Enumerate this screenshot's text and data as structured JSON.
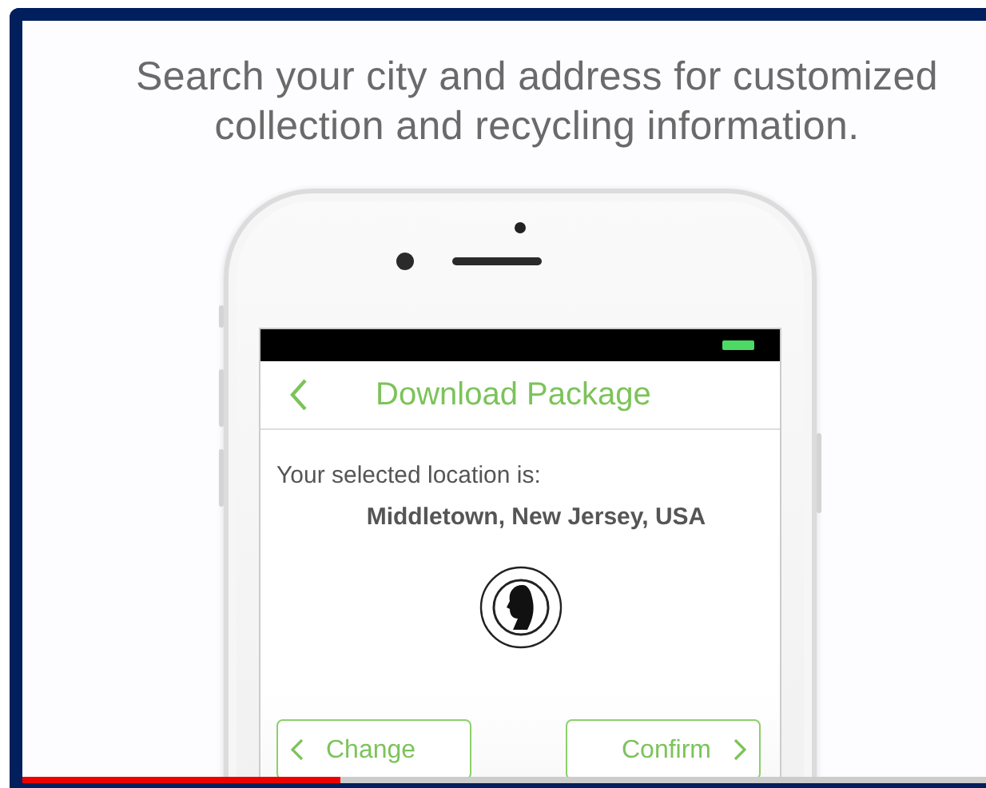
{
  "headline": "Search your city and address for customized collection and recycling information.",
  "app": {
    "title": "Download Package",
    "location_label": "Your selected location is:",
    "location": "Middletown, New Jersey, USA",
    "buttons": [
      {
        "label": "Change",
        "kind": "back"
      },
      {
        "label": "Confirm",
        "kind": "forward"
      }
    ]
  },
  "video": {
    "progress": {
      "level": 0.33
    }
  }
}
